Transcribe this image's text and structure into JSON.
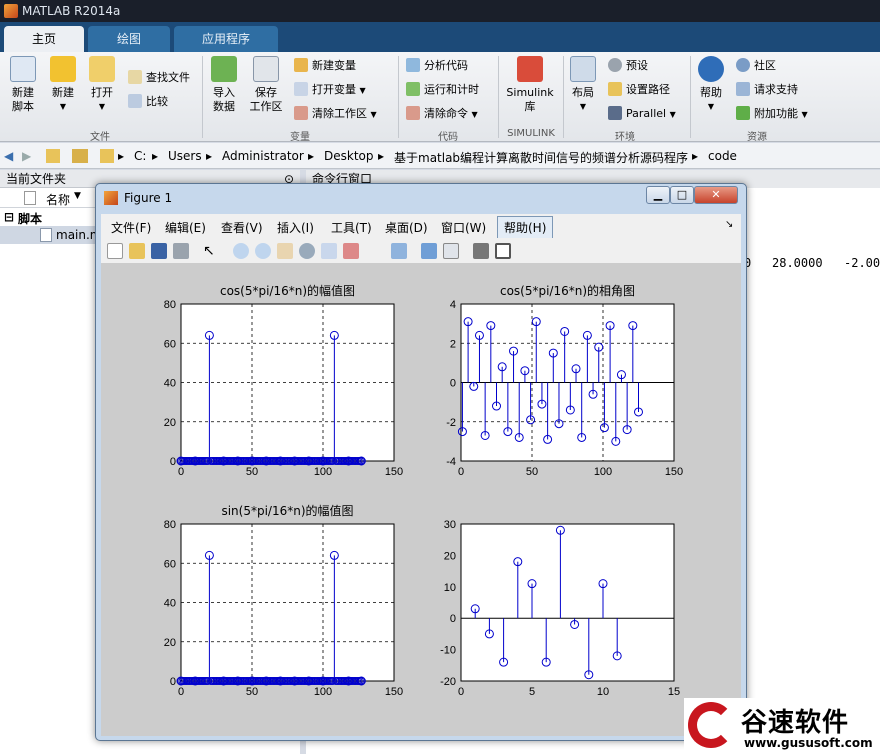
{
  "window": {
    "title": "MATLAB R2014a"
  },
  "tabs": [
    {
      "label": "主页"
    },
    {
      "label": "绘图"
    },
    {
      "label": "应用程序"
    }
  ],
  "ribbon": {
    "file": {
      "new_script": "新建\n脚本",
      "new": "新建",
      "open": "打开",
      "find_files": "查找文件",
      "compare": "比较",
      "group": "文件"
    },
    "variable": {
      "import": "导入\n数据",
      "save": "保存\n工作区",
      "new_var": "新建变量",
      "open_var": "打开变量",
      "clear_ws": "清除工作区",
      "group": "变量"
    },
    "code": {
      "analyze": "分析代码",
      "run_time": "运行和计时",
      "clear_cmd": "清除命令",
      "group": "代码"
    },
    "simulink": {
      "library": "Simulink\n库",
      "group": "SIMULINK"
    },
    "env": {
      "layout": "布局",
      "prefs": "预设",
      "set_path": "设置路径",
      "parallel": "Parallel",
      "group": "环境"
    },
    "resources": {
      "help": "帮助",
      "community": "社区",
      "request_support": "请求支持",
      "addons": "附加功能",
      "group": "资源"
    }
  },
  "address": {
    "parts": [
      "C:",
      "Users",
      "Administrator",
      "Desktop",
      "基于matlab编程计算离散时间信号的频谱分析源码程序",
      "code"
    ]
  },
  "left_panel": {
    "title": "当前文件夹",
    "col_name": "名称",
    "group": "脚本",
    "file": "main.m"
  },
  "command_window": {
    "title": "命令行窗口",
    "output": [
      "0",
      "28.0000",
      "-2.00"
    ]
  },
  "figure": {
    "title": "Figure 1",
    "menu": [
      "文件(F)",
      "编辑(E)",
      "查看(V)",
      "插入(I)",
      "工具(T)",
      "桌面(D)",
      "窗口(W)",
      "帮助(H)"
    ]
  },
  "colors": {
    "stem": "#0000cc",
    "matlab": "#e0742a",
    "logo_red": "#c8161e"
  },
  "watermark": {
    "brand": "谷速软件",
    "url": "www.gususoft.com"
  },
  "chart_data": [
    {
      "type": "stem",
      "title": "cos(5*pi/16*n)的幅值图",
      "xlim": [
        0,
        150
      ],
      "ylim": [
        0,
        80
      ],
      "xticks": [
        0,
        50,
        100,
        150
      ],
      "yticks": [
        0,
        20,
        40,
        60,
        80
      ],
      "grid": true,
      "x": [
        0,
        10,
        20,
        30,
        40,
        50,
        60,
        70,
        80,
        90,
        100,
        108,
        118,
        127
      ],
      "values": [
        0,
        0,
        64,
        0,
        0,
        0,
        0,
        0,
        0,
        0,
        0,
        64,
        0,
        0
      ]
    },
    {
      "type": "stem",
      "title": "cos(5*pi/16*n)的相角图",
      "xlim": [
        0,
        150
      ],
      "ylim": [
        -4,
        4
      ],
      "xticks": [
        0,
        50,
        100,
        150
      ],
      "yticks": [
        -4,
        -2,
        0,
        2,
        4
      ],
      "grid": true,
      "x": [
        1,
        5,
        9,
        13,
        17,
        21,
        25,
        29,
        33,
        37,
        41,
        45,
        49,
        53,
        57,
        61,
        65,
        69,
        73,
        77,
        81,
        85,
        89,
        93,
        97,
        101,
        105,
        109,
        113,
        117,
        121,
        125
      ],
      "values": [
        -2.5,
        3.1,
        -0.2,
        2.4,
        -2.7,
        2.9,
        -1.2,
        0.8,
        -2.5,
        1.6,
        -2.8,
        0.6,
        -1.9,
        3.1,
        -1.1,
        -2.9,
        1.5,
        -2.1,
        2.6,
        -1.4,
        0.7,
        -2.8,
        2.4,
        -0.6,
        1.8,
        -2.3,
        2.9,
        -3.0,
        0.4,
        -2.4,
        2.9,
        -1.5
      ]
    },
    {
      "type": "stem",
      "title": "sin(5*pi/16*n)的幅值图",
      "xlim": [
        0,
        150
      ],
      "ylim": [
        0,
        80
      ],
      "xticks": [
        0,
        50,
        100,
        150
      ],
      "yticks": [
        0,
        20,
        40,
        60,
        80
      ],
      "grid": true,
      "x": [
        0,
        10,
        20,
        30,
        40,
        50,
        60,
        70,
        80,
        90,
        100,
        108,
        118,
        127
      ],
      "values": [
        0,
        0,
        64,
        0,
        0,
        0,
        0,
        0,
        0,
        0,
        0,
        64,
        0,
        0
      ]
    },
    {
      "type": "stem",
      "title": "",
      "xlim": [
        0,
        15
      ],
      "ylim": [
        -20,
        30
      ],
      "xticks": [
        0,
        5,
        10,
        15
      ],
      "yticks": [
        -20,
        -10,
        0,
        10,
        20,
        30
      ],
      "grid": false,
      "x": [
        1,
        2,
        3,
        4,
        5,
        6,
        7,
        8,
        9,
        10,
        11
      ],
      "values": [
        3,
        -5,
        -14,
        18,
        11,
        -14,
        28,
        -2,
        -18,
        11,
        -12
      ]
    }
  ]
}
